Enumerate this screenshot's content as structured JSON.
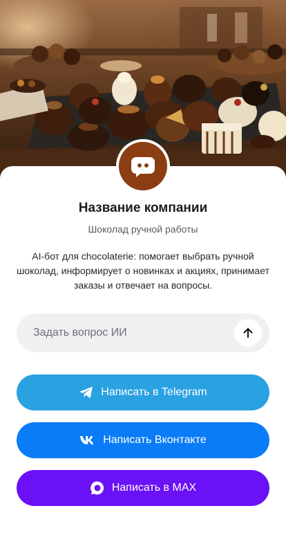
{
  "hero": {
    "image": "handmade-chocolate-truffles-photo"
  },
  "company": {
    "avatar_icon": "chat-bubble-icon",
    "name": "Название компании",
    "subtitle": "Шоколад ручной работы",
    "description": "AI-бот для chocolaterie: помогает выбрать ручной шоколад, информирует о новинках и акциях, принимает заказы и отвечает на вопросы."
  },
  "ask": {
    "placeholder": "Задать вопрос ИИ",
    "value": "",
    "send_icon": "arrow-up-icon"
  },
  "buttons": {
    "telegram": {
      "label": "Написать в Telegram",
      "icon": "telegram-icon",
      "color": "#2aa1e1"
    },
    "vk": {
      "label": "Написать Вконтакте",
      "icon": "vk-icon",
      "color": "#0a7cf7"
    },
    "max": {
      "label": "Написать в MAX",
      "icon": "max-icon",
      "color": "#6a11f5"
    }
  },
  "colors": {
    "avatar_bg": "#8a3e12",
    "input_bg": "#f0f0f2",
    "text_primary": "#1d1d1f"
  }
}
